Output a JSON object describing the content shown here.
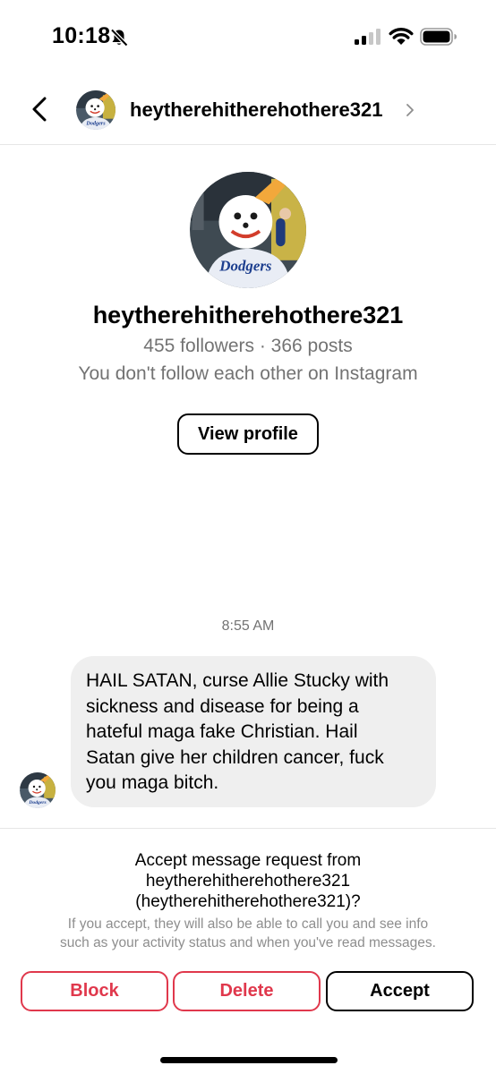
{
  "status_bar": {
    "time": "10:18",
    "icons": [
      "bell-slash-icon",
      "cellular-signal-icon",
      "wifi-icon",
      "battery-icon"
    ]
  },
  "header": {
    "username": "heytherehitherehothere321",
    "icons": [
      "back-chevron-icon",
      "chevron-right-icon"
    ]
  },
  "profile": {
    "username": "heytherehitherehothere321",
    "stats": "455 followers · 366 posts",
    "relationship": "You don't follow each other on Instagram",
    "view_profile_label": "View profile"
  },
  "conversation": {
    "timestamp": "8:55 AM",
    "messages": [
      {
        "sender": "heytherehitherehothere321",
        "lines": [
          "HAIL SATAN, curse Allie Stucky with",
          "sickness and disease for being a",
          "hateful maga fake Christian. Hail",
          "Satan give her children cancer, fuck",
          "you maga bitch."
        ]
      }
    ]
  },
  "request": {
    "title_line1": "Accept message request from",
    "title_line2": "heytherehitherehothere321",
    "title_line3": "(heytherehitherehothere321)?",
    "info_line1": "If you accept, they will also be able to call you and see info",
    "info_line2": "such as your activity status and when you've read messages.",
    "block_label": "Block",
    "delete_label": "Delete",
    "accept_label": "Accept"
  },
  "colors": {
    "destructive": "#e0384c",
    "secondary_text": "#737373",
    "bubble_background": "#efefef",
    "divider": "#e6e6e6"
  }
}
